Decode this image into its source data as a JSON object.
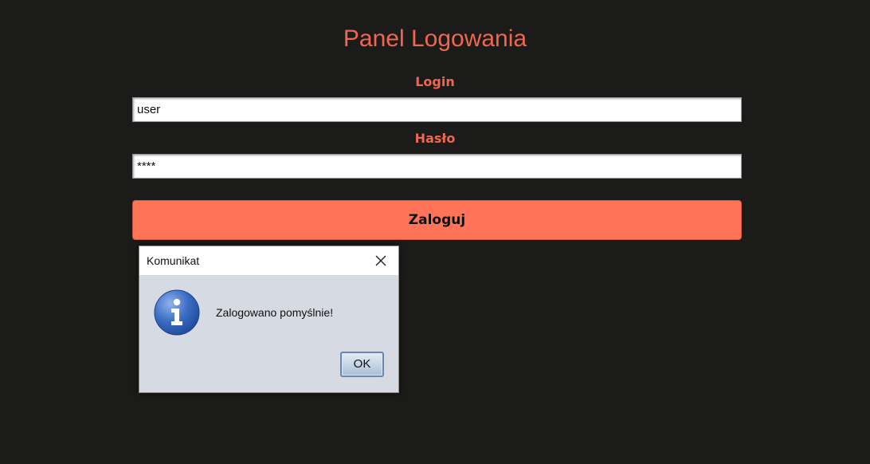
{
  "app": {
    "title": "Panel Logowania"
  },
  "form": {
    "login_label": "Login",
    "login_value": "user",
    "password_label": "Hasło",
    "password_value": "****",
    "submit_label": "Zaloguj"
  },
  "dialog": {
    "title": "Komunikat",
    "message": "Zalogowano pomyślnie!",
    "ok_label": "OK",
    "icon": "info-icon",
    "close_icon": "close-icon"
  },
  "colors": {
    "background": "#1b1b1a",
    "accent_text": "#f2664f",
    "button": "#ff7458",
    "dialog_body": "#d6dae3",
    "info_icon_blue": "#2f5fb3"
  }
}
